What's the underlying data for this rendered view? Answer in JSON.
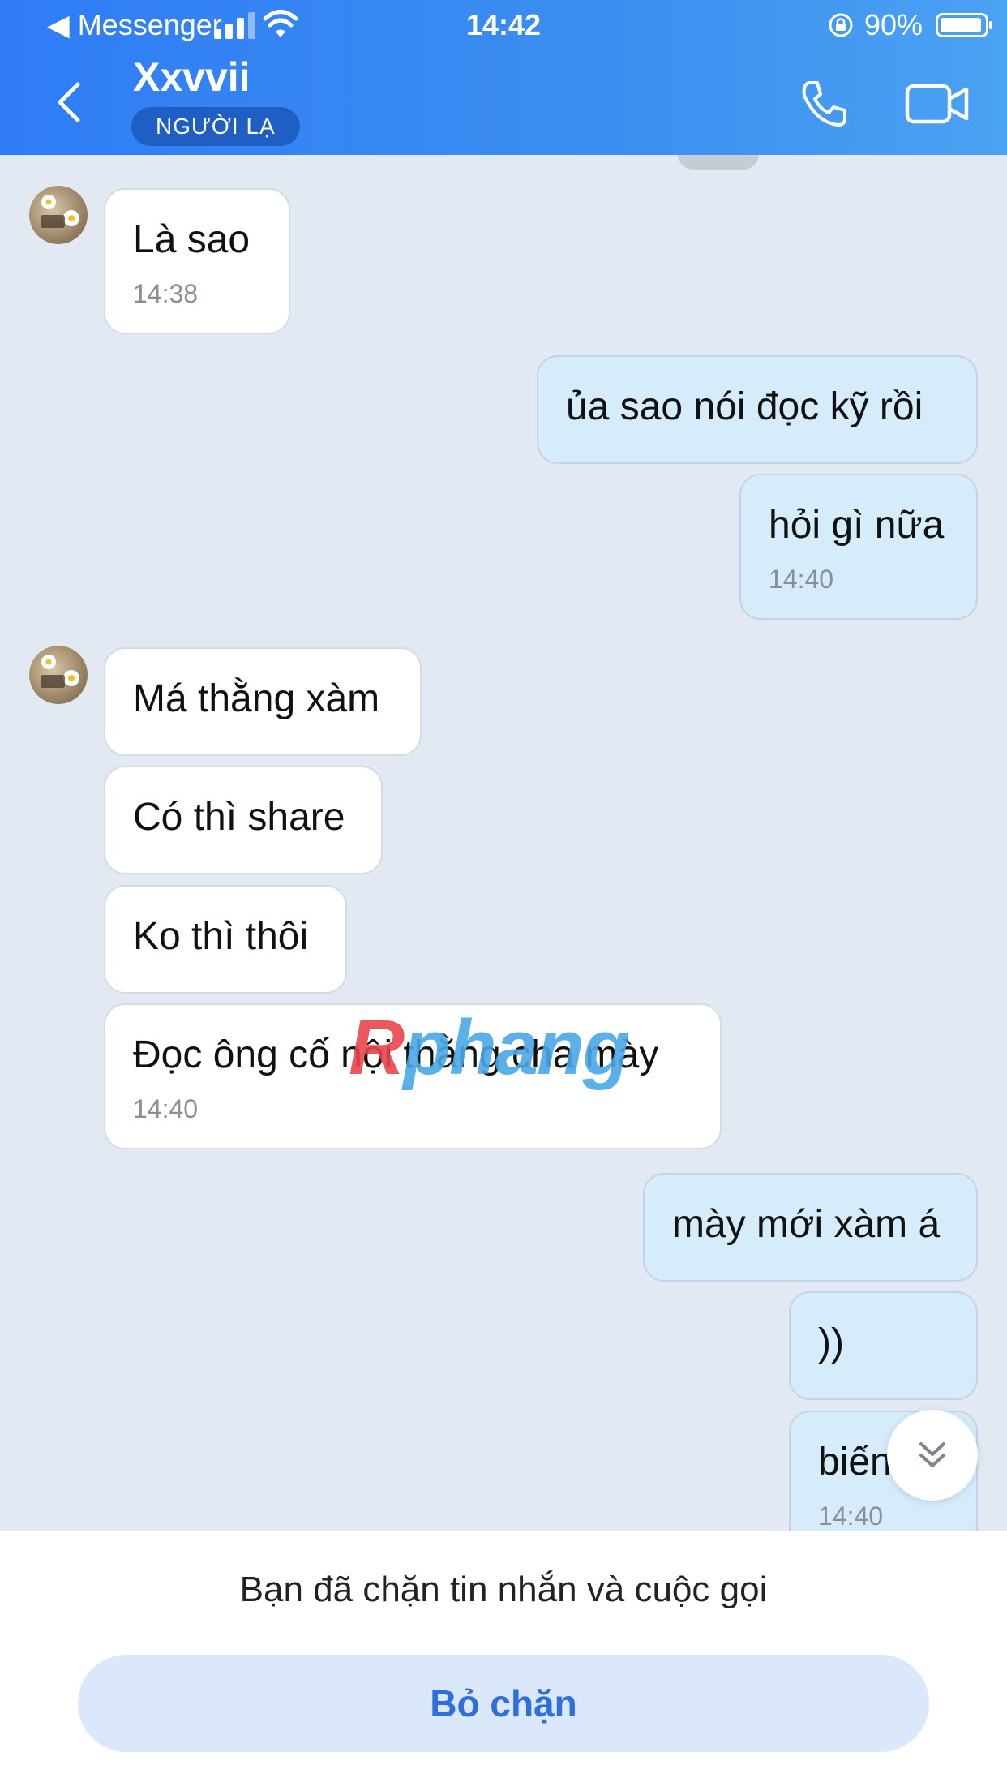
{
  "status_bar": {
    "back_app": "◀ Messenger",
    "time": "14:42",
    "battery": "90%"
  },
  "header": {
    "contact_name": "Xxvvii",
    "badge": "NGƯỜI LẠ"
  },
  "messages": [
    {
      "side": "them",
      "text": "Là sao",
      "time": "14:38"
    },
    {
      "side": "me",
      "text": "ủa sao nói đọc kỹ rồi",
      "time": ""
    },
    {
      "side": "me",
      "text": "hỏi gì nữa",
      "time": "14:40"
    },
    {
      "side": "them",
      "text": "Má thằng xàm",
      "time": ""
    },
    {
      "side": "them",
      "text": "Có thì share",
      "time": ""
    },
    {
      "side": "them",
      "text": "Ko thì thôi",
      "time": ""
    },
    {
      "side": "them",
      "text": "Đọc ông cố nội thằng cha mày",
      "time": "14:40"
    },
    {
      "side": "me",
      "text": "mày mới xàm á",
      "time": ""
    },
    {
      "side": "me",
      "text": "))",
      "time": ""
    },
    {
      "side": "me",
      "text": "biến",
      "time": "14:40"
    }
  ],
  "watermark": {
    "first": "R",
    "rest": "phang"
  },
  "footer": {
    "blocked_text": "Bạn đã chặn tin nhắn và cuộc gọi",
    "unblock_label": "Bỏ chặn"
  },
  "colors": {
    "header_gradient_start": "#2f7cf6",
    "header_gradient_end": "#4aa2f2",
    "my_bubble": "#d6ecfb",
    "their_bubble": "#ffffff",
    "chat_background": "#e2e9f3",
    "accent": "#2e6fde"
  },
  "icons": [
    "signal-icon",
    "wifi-icon",
    "orientation-lock-icon",
    "battery-icon",
    "back-chevron-icon",
    "phone-icon",
    "video-camera-icon",
    "double-chevron-down-icon"
  ]
}
